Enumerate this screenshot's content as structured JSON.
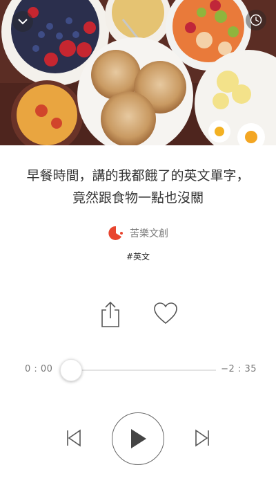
{
  "cover": {
    "image_name": "breakfast-table-photo"
  },
  "header": {
    "collapse_icon": "chevron-down-icon",
    "timer_icon": "clock-icon"
  },
  "episode": {
    "title_line1": "早餐時間，講的我都餓了的英文單字，",
    "title_line2": "竟然跟食物一點也沒關",
    "author": "苦樂文創",
    "tag": "#英文"
  },
  "actions": {
    "share_icon": "share-icon",
    "like_icon": "heart-icon"
  },
  "player": {
    "elapsed": "0 : 00",
    "remaining": "−2 : 35",
    "progress_fraction": 0.0,
    "prev_icon": "skip-previous-icon",
    "play_icon": "play-icon",
    "next_icon": "skip-next-icon"
  },
  "colors": {
    "logo_red": "#e8452f",
    "text": "#333333",
    "muted": "#777777"
  }
}
